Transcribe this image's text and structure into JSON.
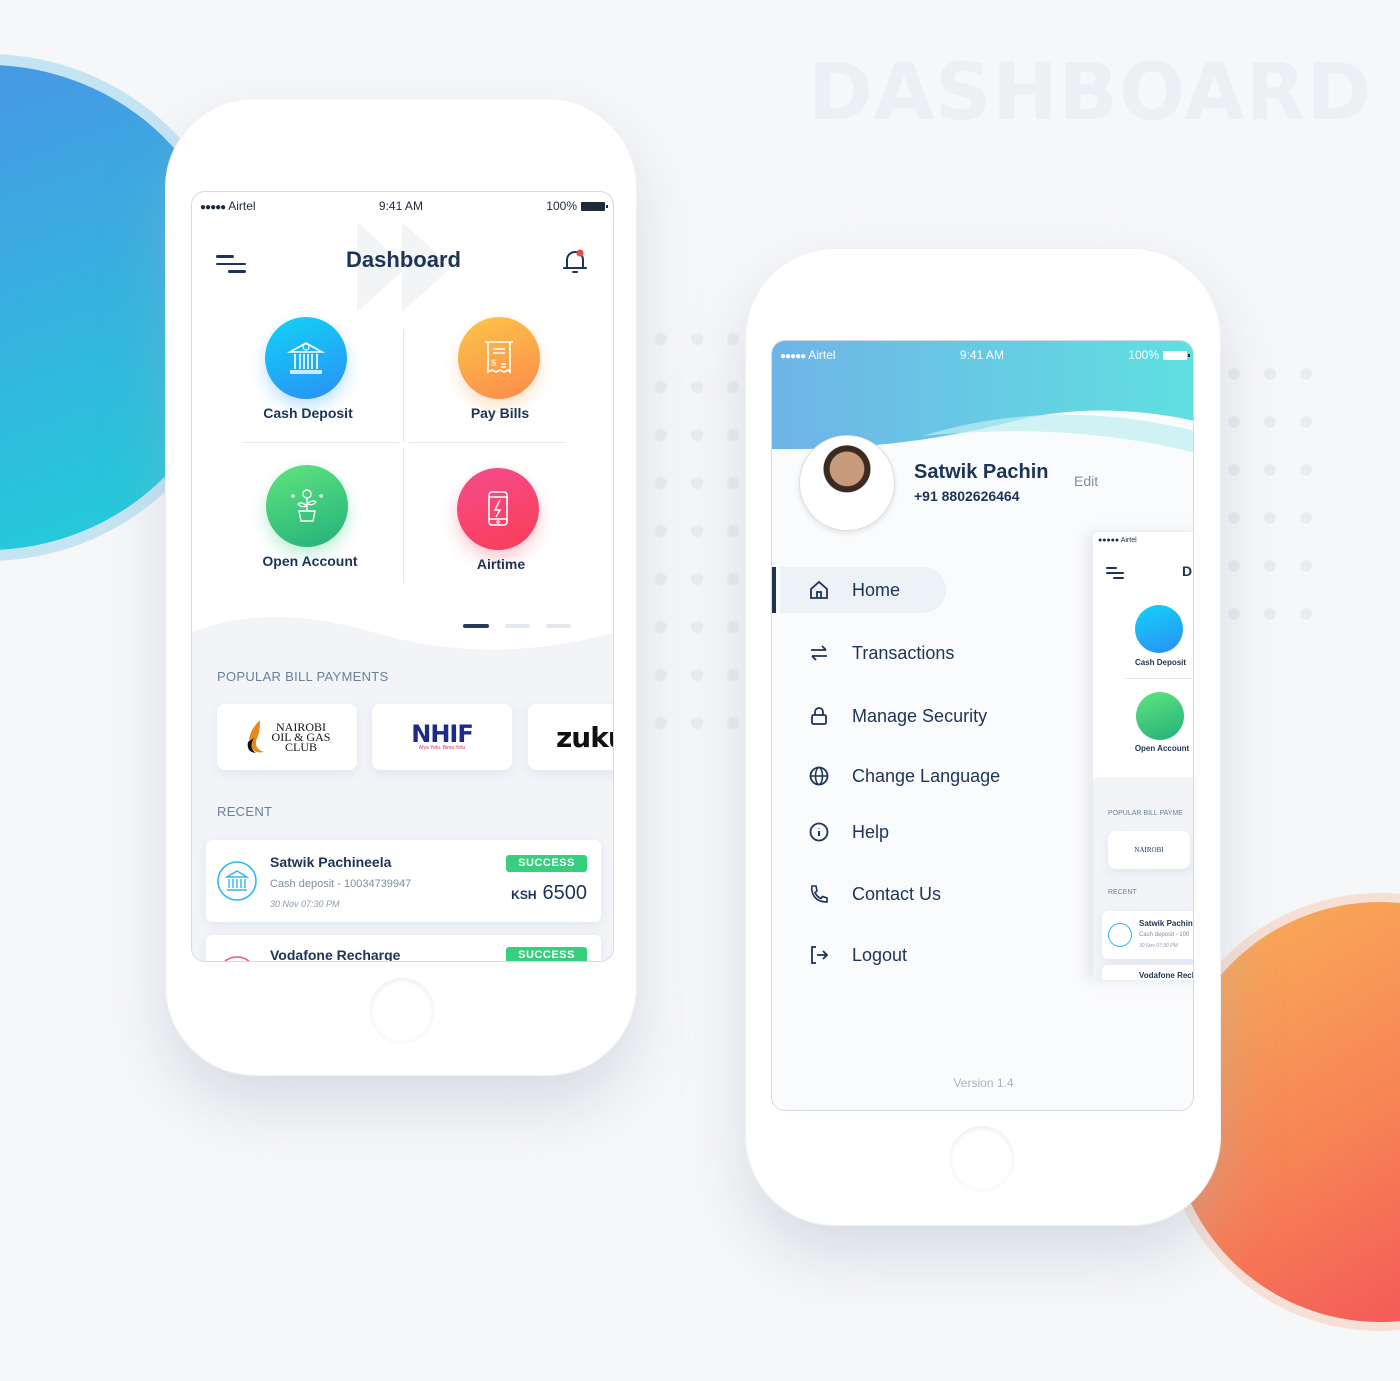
{
  "page_title": "DASHBOARD",
  "colors": {
    "accent_navy": "#1d3456",
    "success": "#35cf7d",
    "blue_circle": "#35b3df",
    "orange_circle": "#f78355"
  },
  "status_bar": {
    "carrier": "Airtel",
    "signal": "●●●●●",
    "time": "9:41 AM",
    "battery": "100%"
  },
  "left_phone": {
    "header": {
      "title": "Dashboard",
      "menu_icon": "menu-icon",
      "notification_icon": "bell-icon"
    },
    "tiles": [
      {
        "label": "Cash Deposit",
        "icon": "bank-icon",
        "color": "#1ab4f5"
      },
      {
        "label": "Pay Bills",
        "icon": "receipt-icon",
        "color": "#fb9d4a"
      },
      {
        "label": "Open Account",
        "icon": "plant-money-icon",
        "color": "#39c978"
      },
      {
        "label": "Airtime",
        "icon": "phone-bolt-icon",
        "color": "#f7406a"
      }
    ],
    "pager": {
      "pages": 3,
      "active": 1
    },
    "popular_heading": "POPULAR BILL PAYMENTS",
    "billers": [
      {
        "name": "NAIROBI OIL & GAS CLUB",
        "line1": "NAIROBI",
        "line2": "OIL & GAS",
        "line3": "CLUB"
      },
      {
        "name": "NHIF",
        "tagline": "Afya Yetu. Bima Yetu"
      },
      {
        "name": "zuku"
      }
    ],
    "recent_heading": "RECENT",
    "transactions": [
      {
        "name": "Satwik Pachineela",
        "desc": "Cash deposit - 10034739947",
        "date": "30 Nov  07:30 PM",
        "status": "SUCCESS",
        "currency": "KSH",
        "amount": "6500"
      },
      {
        "name": "Vodafone Recharge",
        "status": "SUCCESS"
      }
    ]
  },
  "right_phone": {
    "profile": {
      "name": "Satwik Pachin",
      "phone": "+91 8802626464",
      "edit_label": "Edit"
    },
    "nav": [
      {
        "label": "Home",
        "icon": "home-icon",
        "active": true
      },
      {
        "label": "Transactions",
        "icon": "transfer-icon"
      },
      {
        "label": "Manage Security",
        "icon": "lock-icon"
      },
      {
        "label": "Change Language",
        "icon": "globe-icon"
      },
      {
        "label": "Help",
        "icon": "info-icon"
      },
      {
        "label": "Contact Us",
        "icon": "phone-icon"
      },
      {
        "label": "Logout",
        "icon": "logout-icon"
      }
    ],
    "version": "Version 1.4",
    "preview": {
      "carrier": "●●●●● Airtel",
      "title_partial": "D",
      "tiles": [
        "Cash Deposit",
        "Open Account"
      ],
      "popular_heading": "POPULAR BILL PAYME",
      "recent_heading": "RECENT",
      "tx_name": "Satwik Pachin",
      "tx_desc": "Cash deposit - 100",
      "tx_date": "30 Nov  07:30 PM",
      "tx2_name": "Vodafone Recl"
    }
  }
}
